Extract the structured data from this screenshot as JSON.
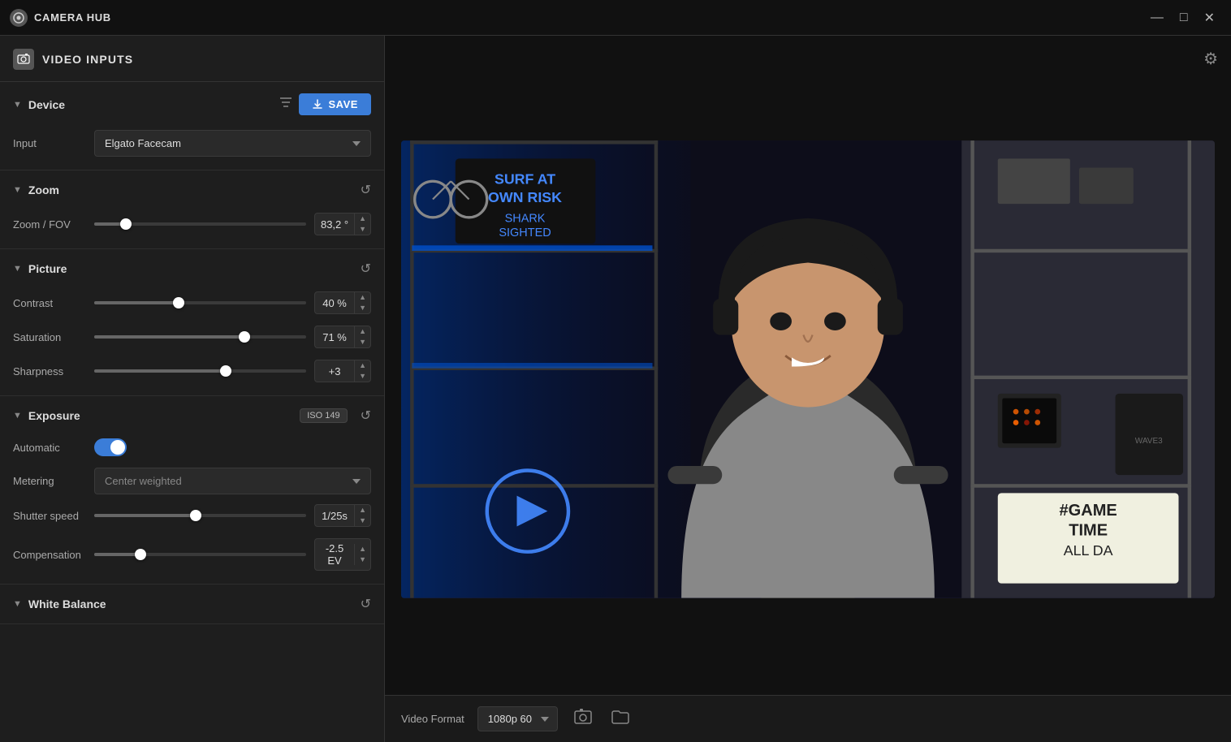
{
  "titleBar": {
    "appName": "CAMERA HUB",
    "minBtn": "—",
    "maxBtn": "□",
    "closeBtn": "✕"
  },
  "leftPanel": {
    "headerIcon": "◈",
    "headerTitle": "VIDEO INPUTS"
  },
  "sections": {
    "device": {
      "title": "Device",
      "inputLabel": "Input",
      "inputValue": "Elgato Facecam",
      "saveLabel": "SAVE"
    },
    "zoom": {
      "title": "Zoom",
      "zoomFovLabel": "Zoom / FOV",
      "zoomFovValue": "83,2 °",
      "zoomPercent": 15
    },
    "picture": {
      "title": "Picture",
      "contrastLabel": "Contrast",
      "contrastValue": "40 %",
      "contrastPercent": 40,
      "saturationLabel": "Saturation",
      "saturationValue": "71 %",
      "saturationPercent": 71,
      "sharpnessLabel": "Sharpness",
      "sharpnessValue": "+3",
      "sharpnessPercent": 62
    },
    "exposure": {
      "title": "Exposure",
      "isoBadge": "ISO  149",
      "automaticLabel": "Automatic",
      "automaticOn": true,
      "meteringLabel": "Metering",
      "meteringValue": "Center weighted",
      "shutterLabel": "Shutter speed",
      "shutterValue": "1/25s",
      "shutterPercent": 48,
      "compensationLabel": "Compensation",
      "compensationValue": "-2.5 EV",
      "compensationPercent": 22
    },
    "whiteBalance": {
      "title": "White Balance"
    }
  },
  "videoBar": {
    "formatLabel": "Video Format",
    "formatValue": "1080p 60",
    "screenshotIcon": "⊙",
    "folderIcon": "🗁"
  },
  "gearIcon": "⚙"
}
